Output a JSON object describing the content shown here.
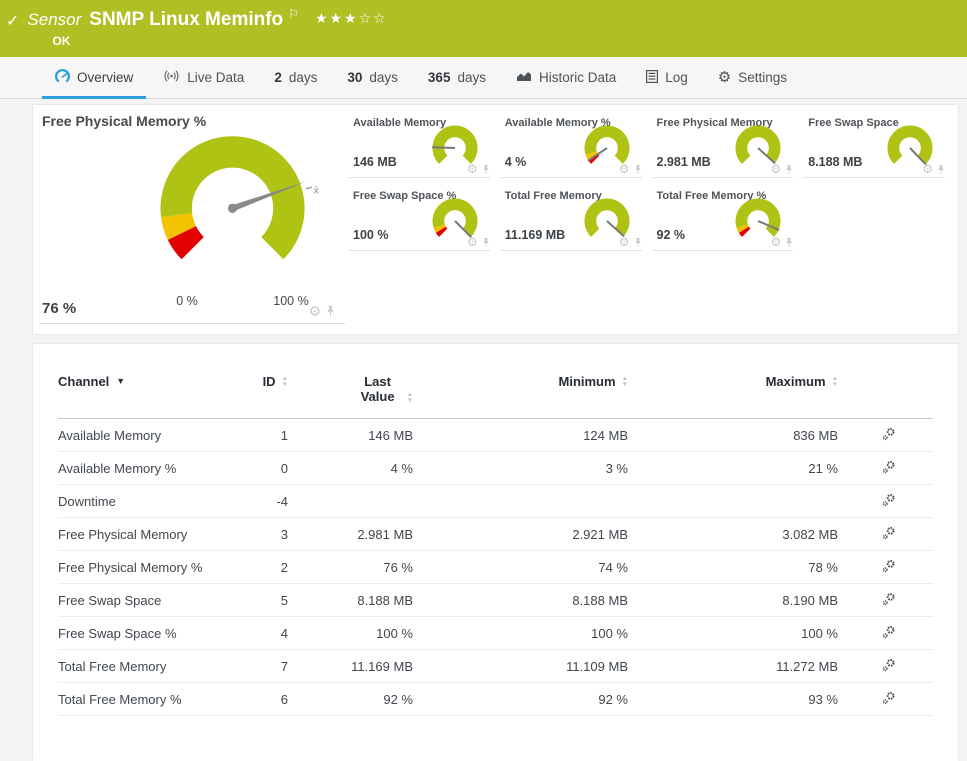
{
  "header": {
    "check_icon": "✓",
    "kind_label": "Sensor",
    "title": "SNMP Linux Meminfo",
    "flag_icon": "⚐",
    "stars": "★★★☆☆",
    "status": "OK"
  },
  "tabs": [
    {
      "label": "Overview",
      "icon": "gauge-icon",
      "active": true
    },
    {
      "label": "Live Data",
      "icon": "broadcast-icon"
    },
    {
      "num": "2",
      "label": "days"
    },
    {
      "num": "30",
      "label": "days"
    },
    {
      "num": "365",
      "label": "days"
    },
    {
      "label": "Historic Data",
      "icon": "chart-icon"
    },
    {
      "label": "Log",
      "icon": "log-icon"
    },
    {
      "label": "Settings",
      "icon": "gear-icon"
    }
  ],
  "colors": {
    "header_green": "#b0bf23",
    "gauge_green": "#aec313",
    "gauge_yellow": "#f3c200",
    "gauge_red": "#e30000",
    "accent_blue": "#2ba0dc"
  },
  "main_gauge": {
    "title": "Free Physical Memory %",
    "value": "76 %",
    "scale_min_label": "0 %",
    "scale_max_label": "100 %",
    "needle_deg": 70,
    "avg_marker_label": "x̄"
  },
  "gauge_tiles": [
    {
      "title": "Available Memory",
      "value": "146 MB",
      "needle_deg": 272,
      "has_limits": false
    },
    {
      "title": "Available Memory %",
      "value": "4 %",
      "needle_deg": 236,
      "has_limits": true
    },
    {
      "title": "Free Physical Memory",
      "value": "2.981 MB",
      "needle_deg": 132,
      "has_limits": false
    },
    {
      "title": "Free Swap Space",
      "value": "8.188 MB",
      "needle_deg": 136,
      "has_limits": false
    },
    {
      "title": "Free Swap Space %",
      "value": "100 %",
      "needle_deg": 135,
      "has_limits": true
    },
    {
      "title": "Total Free Memory",
      "value": "11.169 MB",
      "needle_deg": 132,
      "has_limits": false
    },
    {
      "title": "Total Free Memory %",
      "value": "92 %",
      "needle_deg": 113,
      "has_limits": true
    }
  ],
  "table": {
    "columns": [
      {
        "label": "Channel",
        "sorted": true
      },
      {
        "label": "ID",
        "sortable": true
      },
      {
        "label": "Last Value",
        "sortable": true
      },
      {
        "label": "Minimum",
        "sortable": true
      },
      {
        "label": "Maximum",
        "sortable": true
      }
    ],
    "rows": [
      {
        "channel": "Available Memory",
        "id": "1",
        "last": "146 MB",
        "min": "124 MB",
        "max": "836 MB"
      },
      {
        "channel": "Available Memory %",
        "id": "0",
        "last": "4 %",
        "min": "3 %",
        "max": "21 %"
      },
      {
        "channel": "Downtime",
        "id": "-4",
        "last": "",
        "min": "",
        "max": ""
      },
      {
        "channel": "Free Physical Memory",
        "id": "3",
        "last": "2.981 MB",
        "min": "2.921 MB",
        "max": "3.082 MB"
      },
      {
        "channel": "Free Physical Memory %",
        "id": "2",
        "last": "76 %",
        "min": "74 %",
        "max": "78 %"
      },
      {
        "channel": "Free Swap Space",
        "id": "5",
        "last": "8.188 MB",
        "min": "8.188 MB",
        "max": "8.190 MB"
      },
      {
        "channel": "Free Swap Space %",
        "id": "4",
        "last": "100 %",
        "min": "100 %",
        "max": "100 %"
      },
      {
        "channel": "Total Free Memory",
        "id": "7",
        "last": "11.169 MB",
        "min": "11.109 MB",
        "max": "11.272 MB"
      },
      {
        "channel": "Total Free Memory %",
        "id": "6",
        "last": "92 %",
        "min": "92 %",
        "max": "93 %"
      }
    ]
  }
}
